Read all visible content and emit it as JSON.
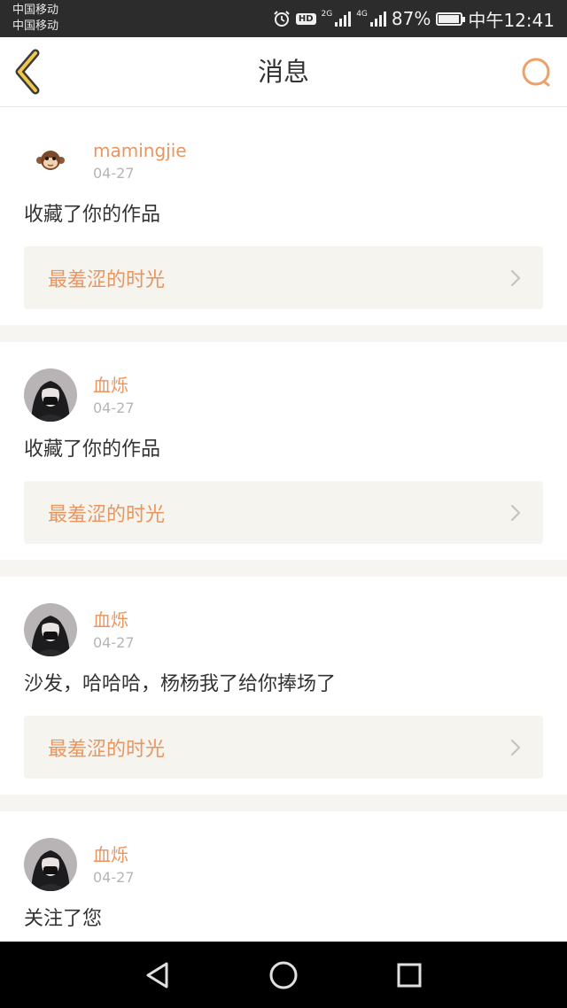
{
  "status_bar": {
    "carrier_1": "中国移动",
    "carrier_2": "中国移动",
    "sig1_tag": "2G",
    "sig2_tag": "4G",
    "battery": "87%",
    "time": "中午12:41",
    "icons": [
      "alarm-icon",
      "hd-icon",
      "signal-icon",
      "signal-icon",
      "battery-icon"
    ]
  },
  "header": {
    "title": "消息",
    "back_icon": "chevron-left-icon",
    "search_icon": "search-icon",
    "accent_color": "#e9955f"
  },
  "messages": [
    {
      "avatar": "monkey-avatar",
      "username": "mamingjie",
      "date": "04-27",
      "text": "收藏了你的作品",
      "work_title": "最羞涩的时光"
    },
    {
      "avatar": "masked-girl-avatar",
      "username": "血烁",
      "date": "04-27",
      "text": "收藏了你的作品",
      "work_title": "最羞涩的时光"
    },
    {
      "avatar": "masked-girl-avatar",
      "username": "血烁",
      "date": "04-27",
      "text": "沙发，哈哈哈，杨杨我了给你捧场了",
      "work_title": "最羞涩的时光"
    },
    {
      "avatar": "masked-girl-avatar",
      "username": "血烁",
      "date": "04-27",
      "text": "关注了您",
      "work_title": ""
    }
  ],
  "nav_bar": {
    "buttons": [
      "back-triangle-icon",
      "home-circle-icon",
      "recents-square-icon"
    ]
  }
}
